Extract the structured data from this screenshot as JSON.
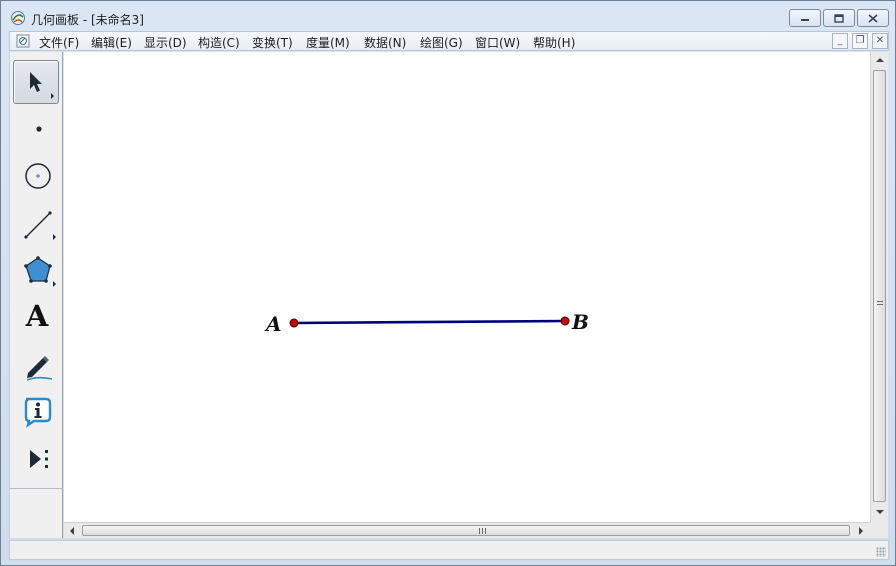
{
  "window": {
    "title": "几何画板 - [未命名3]",
    "controls": {
      "minimize": "minimize",
      "maximize": "maximize",
      "close": "close"
    }
  },
  "menubar": {
    "items": [
      {
        "label": "文件(F)"
      },
      {
        "label": "编辑(E)"
      },
      {
        "label": "显示(D)"
      },
      {
        "label": "构造(C)"
      },
      {
        "label": "变换(T)"
      },
      {
        "label": "度量(M)"
      },
      {
        "label": "数据(N)"
      },
      {
        "label": "绘图(G)"
      },
      {
        "label": "窗口(W)"
      },
      {
        "label": "帮助(H)"
      }
    ],
    "mdi_controls": {
      "minimize": "_",
      "restore": "❐",
      "close": "✕"
    }
  },
  "toolbox": {
    "tools": [
      {
        "name": "arrow-select-tool",
        "icon": "arrow-icon",
        "active": true
      },
      {
        "name": "point-tool",
        "icon": "point-icon"
      },
      {
        "name": "compass-tool",
        "icon": "circle-icon"
      },
      {
        "name": "straightedge-tool",
        "icon": "segment-icon"
      },
      {
        "name": "polygon-tool",
        "icon": "pentagon-icon"
      },
      {
        "name": "text-tool",
        "icon": "text-icon",
        "glyph": "A"
      },
      {
        "name": "marker-tool",
        "icon": "marker-pen-icon"
      },
      {
        "name": "information-tool",
        "icon": "info-icon",
        "glyph": "i"
      },
      {
        "name": "custom-tool",
        "icon": "play-more-icon"
      }
    ]
  },
  "canvas": {
    "points": [
      {
        "label": "A",
        "color": "#d00000"
      },
      {
        "label": "B",
        "color": "#d00000"
      }
    ],
    "segment": {
      "from": "A",
      "to": "B",
      "color": "#000080"
    }
  },
  "colors": {
    "segment": "#000080",
    "point_fill": "#d00000",
    "polygon_fill": "#3d8fd1",
    "info_icon": "#2a8ad0"
  }
}
